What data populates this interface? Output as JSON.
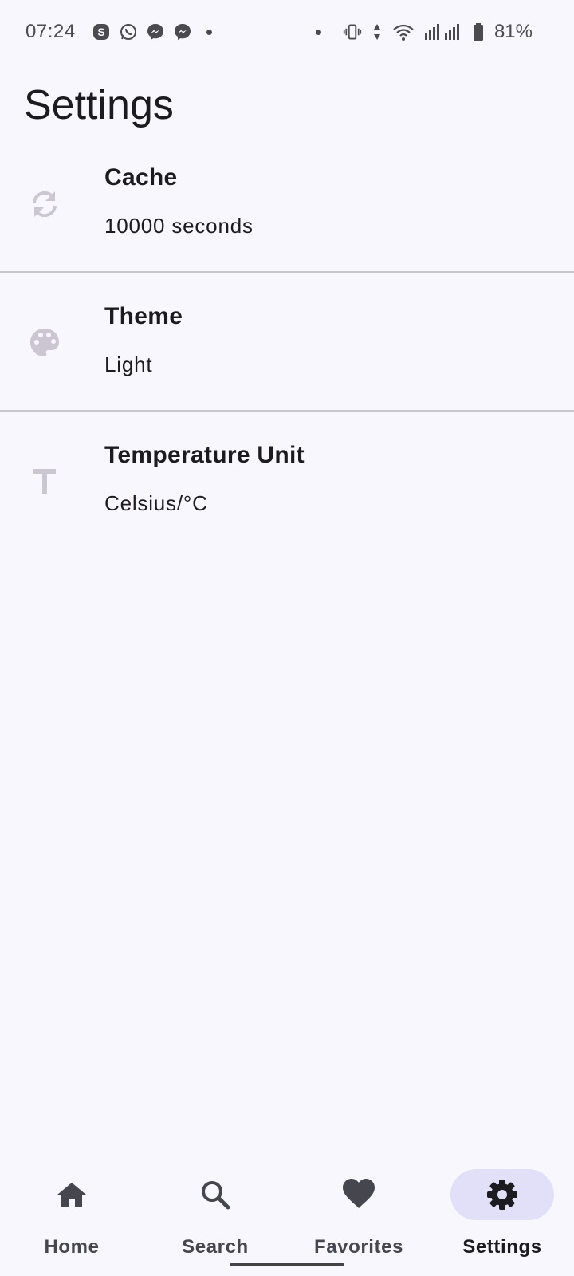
{
  "status_bar": {
    "time": "07:24",
    "battery_percent": "81%",
    "left_icons": [
      "skype-icon",
      "whatsapp-icon",
      "messenger-icon",
      "messenger-icon"
    ],
    "right_icons": [
      "vibrate-icon",
      "data-arrows-icon",
      "wifi-icon",
      "signal-icon",
      "battery-icon"
    ]
  },
  "page": {
    "title": "Settings"
  },
  "settings": {
    "items": [
      {
        "title": "Cache",
        "value": "10000 seconds",
        "icon": "sync-icon"
      },
      {
        "title": "Theme",
        "value": "Light",
        "icon": "palette-icon"
      },
      {
        "title": "Temperature Unit",
        "value": "Celsius/°C",
        "icon": "text-t-icon"
      }
    ]
  },
  "bottom_nav": {
    "items": [
      {
        "label": "Home",
        "icon": "home-icon",
        "active": false
      },
      {
        "label": "Search",
        "icon": "search-icon",
        "active": false
      },
      {
        "label": "Favorites",
        "icon": "heart-icon",
        "active": false
      },
      {
        "label": "Settings",
        "icon": "gear-icon",
        "active": true
      }
    ]
  },
  "colors": {
    "background": "#f8f7fd",
    "active_pill": "#e2e0f9",
    "setting_icon": "#cbc6d2",
    "divider": "#c9c6cf",
    "text": "#1c1b1f"
  }
}
